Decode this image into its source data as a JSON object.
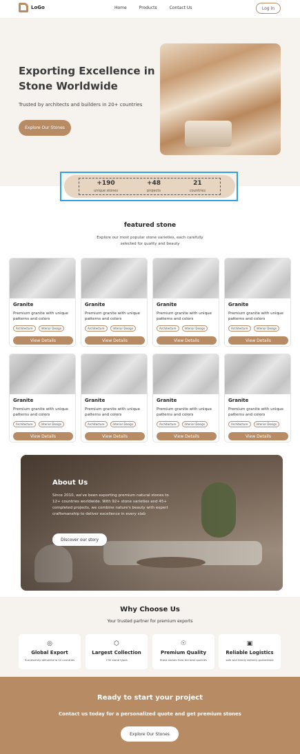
{
  "nav": {
    "logo_text": "LoGo",
    "links": [
      "Home",
      "Products",
      "Contact Us"
    ],
    "login_label": "Log In"
  },
  "hero": {
    "title": "Exporting Excellence in Stone Worldwide",
    "subtitle": "Trusted by architects and builders in 20+ countries",
    "cta_label": "Explore Our Stones"
  },
  "stats": [
    {
      "value": "+190",
      "label": "unique stones"
    },
    {
      "value": "+48",
      "label": "projects"
    },
    {
      "value": "21",
      "label": "countries"
    }
  ],
  "featured": {
    "title": "featured stone",
    "subtitle": "Explore our most popular stone varieties, each carefully selected for quality and beauty",
    "cards": [
      {
        "name": "Granite",
        "description": "Premium granite with unique patterns and colors",
        "tags": [
          "Architecture",
          "Interior Design"
        ],
        "button": "View Details"
      },
      {
        "name": "Granite",
        "description": "Premium granite with unique patterns and colors",
        "tags": [
          "Architecture",
          "Interior Design"
        ],
        "button": "View Details"
      },
      {
        "name": "Granite",
        "description": "Premium granite with unique patterns and colors",
        "tags": [
          "Architecture",
          "Interior Design"
        ],
        "button": "View Details"
      },
      {
        "name": "Granite",
        "description": "Premium granite with unique patterns and colors",
        "tags": [
          "Architecture",
          "Interior Design"
        ],
        "button": "View Details"
      },
      {
        "name": "Granite",
        "description": "Premium granite with unique patterns and colors",
        "tags": [
          "Architecture",
          "Interior Design"
        ],
        "button": "View Details"
      },
      {
        "name": "Granite",
        "description": "Premium granite with unique patterns and colors",
        "tags": [
          "Architecture",
          "Interior Design"
        ],
        "button": "View Details"
      },
      {
        "name": "Granite",
        "description": "Premium granite with unique patterns and colors",
        "tags": [
          "Architecture",
          "Interior Design"
        ],
        "button": "View Details"
      },
      {
        "name": "Granite",
        "description": "Premium granite with unique patterns and colors",
        "tags": [
          "Architecture",
          "Interior Design"
        ],
        "button": "View Details"
      }
    ]
  },
  "about": {
    "title": "About Us",
    "text": "Since 2010, we've been exporting premium natural stones to 12+ countries worldwide. With 92+ stone varieties and 45+ completed projects, we combine nature's beauty with expert craftsmanship to deliver excellence in every slab",
    "button": "Discover our story"
  },
  "why": {
    "title": "Why Choose Us",
    "subtitle": "Your trusted partner for premium exports",
    "features": [
      {
        "icon": "globe-icon",
        "title": "Global Export",
        "description": "Successfully delivered to 12 countries"
      },
      {
        "icon": "cube-icon",
        "title": "Largest Collection",
        "description": "+92 stone types"
      },
      {
        "icon": "award-icon",
        "title": "Premium Quality",
        "description": "finest stones from the best quarries"
      },
      {
        "icon": "truck-icon",
        "title": "Reliable Logistics",
        "description": "safe and timely delivery guaranteed"
      }
    ]
  },
  "cta": {
    "title": "Ready to start your project",
    "subtitle": "Contact us today for a personalized quote and get premium stones",
    "button": "Explore Our Stones"
  },
  "colors": {
    "accent": "#b78b64",
    "hero_bg": "#f6f2ee",
    "stats_bg": "#e7d4c1",
    "highlight": "#2e9fe0"
  }
}
